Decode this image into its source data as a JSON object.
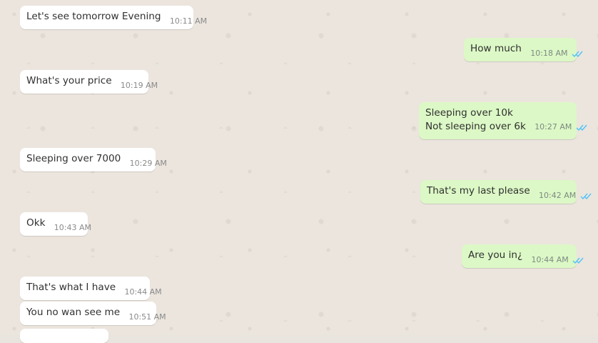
{
  "chat": {
    "messages": [
      {
        "direction": "in",
        "text": "Let's see tomorrow Evening",
        "time": "10:11 AM"
      },
      {
        "direction": "out",
        "text": "How much",
        "time": "10:18 AM",
        "status": "read"
      },
      {
        "direction": "in",
        "text": "What's your price",
        "time": "10:19 AM"
      },
      {
        "direction": "out",
        "lines": [
          "Sleeping over 10k",
          "Not sleeping over 6k"
        ],
        "time": "10:27 AM",
        "status": "read"
      },
      {
        "direction": "in",
        "text": "Sleeping over 7000",
        "time": "10:29 AM"
      },
      {
        "direction": "out",
        "text": "That's my last please",
        "time": "10:42 AM",
        "status": "read"
      },
      {
        "direction": "in",
        "text": "Okk",
        "time": "10:43 AM"
      },
      {
        "direction": "out",
        "text": "Are you in¿",
        "time": "10:44 AM",
        "status": "read"
      },
      {
        "direction": "in",
        "text": "That's what I have",
        "time": "10:44 AM"
      },
      {
        "direction": "in",
        "text": "You no wan see me",
        "time": "10:51 AM"
      }
    ]
  },
  "colors": {
    "incoming_bubble": "#ffffff",
    "outgoing_bubble": "#dcf8c6",
    "read_tick": "#4fc3f7",
    "background": "#ebe5de"
  },
  "icons": {
    "read_receipt": "double-check-icon"
  }
}
